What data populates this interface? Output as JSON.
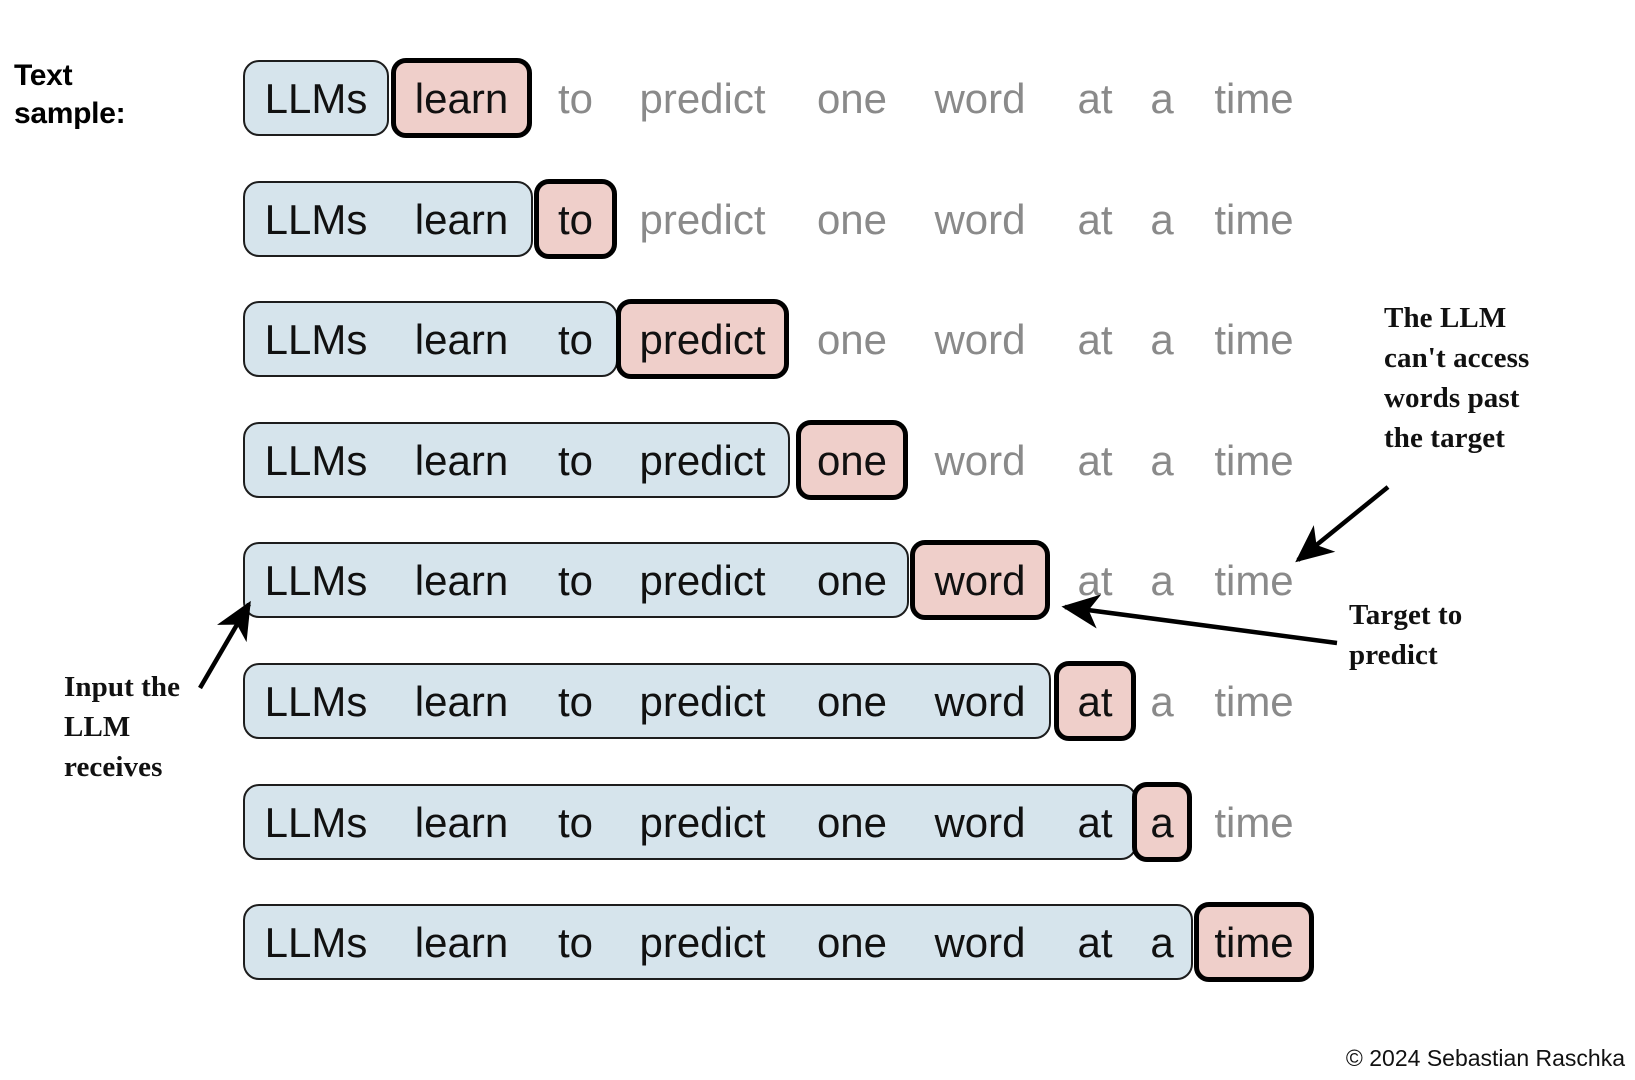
{
  "heading": {
    "text_sample_label": "Text\nsample:"
  },
  "sequence": {
    "words": [
      "LLMs",
      "learn",
      "to",
      "predict",
      "one",
      "word",
      "at",
      "a",
      "time"
    ]
  },
  "rows": [
    {
      "context": [
        "LLMs"
      ],
      "target": "learn",
      "future": [
        "to",
        "predict",
        "one",
        "word",
        "at",
        "a",
        "time"
      ]
    },
    {
      "context": [
        "LLMs",
        "learn"
      ],
      "target": "to",
      "future": [
        "predict",
        "one",
        "word",
        "at",
        "a",
        "time"
      ]
    },
    {
      "context": [
        "LLMs",
        "learn",
        "to"
      ],
      "target": "predict",
      "future": [
        "one",
        "word",
        "at",
        "a",
        "time"
      ]
    },
    {
      "context": [
        "LLMs",
        "learn",
        "to",
        "predict"
      ],
      "target": "one",
      "future": [
        "word",
        "at",
        "a",
        "time"
      ]
    },
    {
      "context": [
        "LLMs",
        "learn",
        "to",
        "predict",
        "one"
      ],
      "target": "word",
      "future": [
        "at",
        "a",
        "time"
      ]
    },
    {
      "context": [
        "LLMs",
        "learn",
        "to",
        "predict",
        "one",
        "word"
      ],
      "target": "at",
      "future": [
        "a",
        "time"
      ]
    },
    {
      "context": [
        "LLMs",
        "learn",
        "to",
        "predict",
        "one",
        "word",
        "at"
      ],
      "target": "a",
      "future": [
        "time"
      ]
    },
    {
      "context": [
        "LLMs",
        "learn",
        "to",
        "predict",
        "one",
        "word",
        "at",
        "a"
      ],
      "target": "time",
      "future": []
    }
  ],
  "annotations": {
    "input_note": "Input the\nLLM\nreceives",
    "target_note": "Target to\npredict",
    "no_access_note": "The LLM\ncan't access\nwords past\nthe target"
  },
  "credit": "© 2024 Sebastian Raschka",
  "colors": {
    "context_fill": "#d6e4ec",
    "context_border": "#1d1d1d",
    "target_fill": "#efcfca",
    "target_border": "#000000",
    "future_text": "#8a8a8a",
    "active_text": "#111111",
    "background": "#ffffff"
  }
}
